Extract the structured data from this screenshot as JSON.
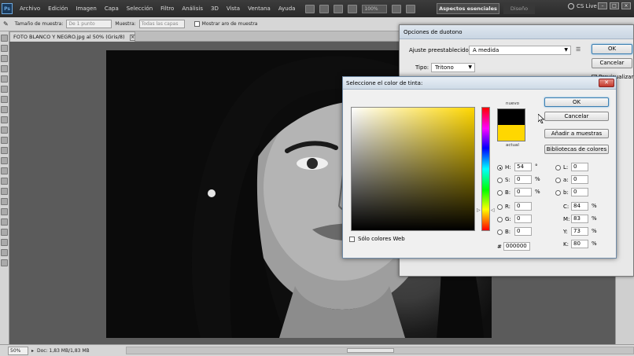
{
  "menubar": {
    "logo": "Ps",
    "items": [
      "Archivo",
      "Edición",
      "Imagen",
      "Capa",
      "Selección",
      "Filtro",
      "Análisis",
      "3D",
      "Vista",
      "Ventana",
      "Ayuda"
    ],
    "zoom": "100%",
    "workspace_active": "Aspectos esenciales",
    "workspace_other": "Diseño",
    "cslive": "CS Live",
    "win_buttons": [
      "–",
      "□",
      "×"
    ]
  },
  "optionsbar": {
    "sample_size_label": "Tamaño de muestra:",
    "sample_size_value": "De 1 punto",
    "sample_label": "Muestra:",
    "sample_value": "Todas las capas",
    "show_ring_label": "Mostrar aro de muestra"
  },
  "document": {
    "tab_title": "FOTO BLANCO Y NEGRO.jpg al 50% (Gris/8)",
    "tab_close": "×"
  },
  "statusbar": {
    "zoom": "50%",
    "doc_size": "Doc: 1,83 MB/1,83 MB"
  },
  "duotone": {
    "title": "Opciones de duotono",
    "preset_label": "Ajuste preestablecido:",
    "preset_value": "A medida",
    "type_label": "Tipo:",
    "type_value": "Tritono",
    "ok": "OK",
    "cancel": "Cancelar",
    "preview_label": "Previsualizar",
    "preview_checked": "✓"
  },
  "picker": {
    "title": "Seleccione el color de tinta:",
    "close": "✕",
    "new_label": "nuevo",
    "current_label": "actual",
    "new_color": "#000000",
    "current_color": "#ffd700",
    "ok": "OK",
    "cancel": "Cancelar",
    "add_swatch": "Añadir a muestras",
    "libraries": "Bibliotecas de colores",
    "web_only": "Sólo colores Web",
    "hsb": [
      {
        "label": "H:",
        "value": "54",
        "unit": "°",
        "selected": true
      },
      {
        "label": "S:",
        "value": "0",
        "unit": "%",
        "selected": false
      },
      {
        "label": "B:",
        "value": "0",
        "unit": "%",
        "selected": false
      }
    ],
    "rgb": [
      {
        "label": "R:",
        "value": "0"
      },
      {
        "label": "G:",
        "value": "0"
      },
      {
        "label": "B:",
        "value": "0"
      }
    ],
    "lab": [
      {
        "label": "L:",
        "value": "0"
      },
      {
        "label": "a:",
        "value": "0"
      },
      {
        "label": "b:",
        "value": "0"
      }
    ],
    "cmyk": [
      {
        "label": "C:",
        "value": "84",
        "unit": "%"
      },
      {
        "label": "M:",
        "value": "83",
        "unit": "%"
      },
      {
        "label": "Y:",
        "value": "73",
        "unit": "%"
      },
      {
        "label": "K:",
        "value": "80",
        "unit": "%"
      }
    ],
    "hex_label": "#",
    "hex_value": "000000"
  }
}
